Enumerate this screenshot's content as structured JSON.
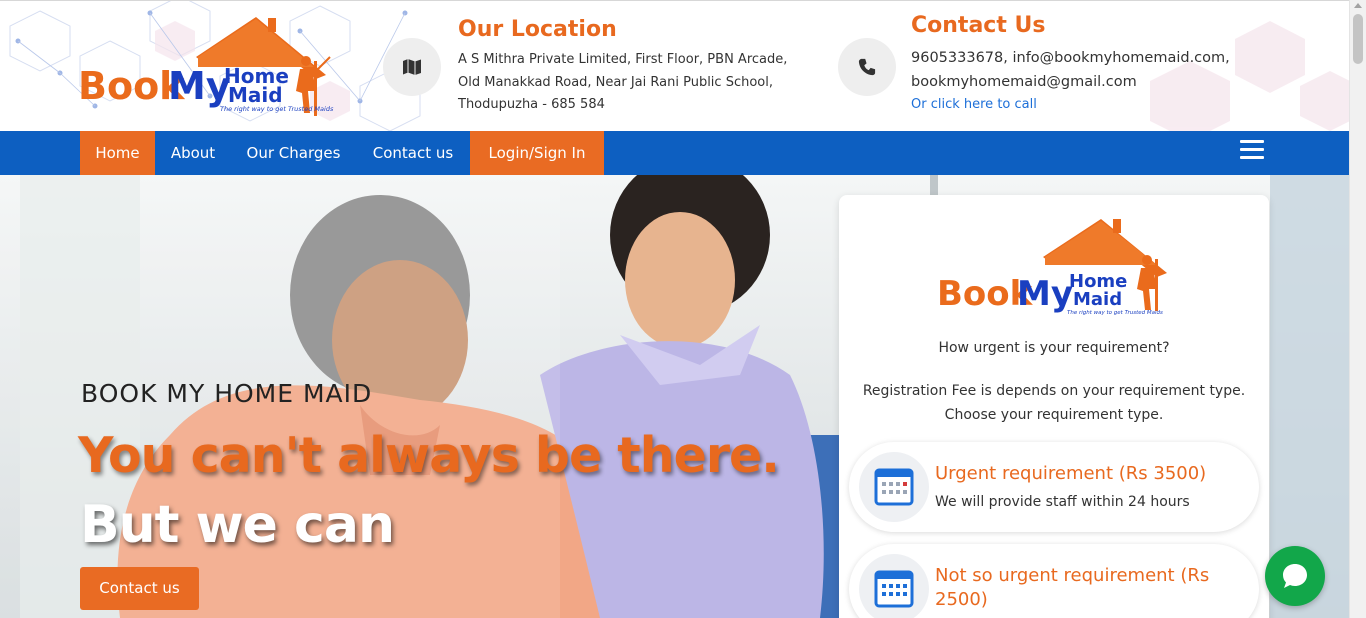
{
  "brand": {
    "word_book": "Book",
    "word_my": "My",
    "word_home": "Home",
    "word_maid": "Maid",
    "tagline": "The right way to get Trusted Maids"
  },
  "location": {
    "title": "Our Location",
    "line1": "A S Mithra Private Limited, First Floor, PBN Arcade,",
    "line2": "Old Manakkad Road, Near Jai Rani Public School,",
    "line3": "Thodupuzha - 685 584"
  },
  "contact": {
    "title": "Contact Us",
    "line1": "9605333678, info@bookmyhomemaid.com,",
    "line2": "bookmyhomemaid@gmail.com",
    "call_link": "Or click here to call"
  },
  "nav": {
    "items": [
      {
        "label": "Home"
      },
      {
        "label": "About"
      },
      {
        "label": "Our Charges"
      },
      {
        "label": "Contact us"
      },
      {
        "label": "Login/Sign In"
      }
    ]
  },
  "hero": {
    "kicker": "BOOK MY HOME MAID",
    "line1": "You can't always be there.",
    "line2": "But we can",
    "button": "Contact us"
  },
  "card": {
    "question": "How urgent is your requirement?",
    "desc1": "Registration Fee is depends on your requirement type.",
    "desc2": "Choose your requirement type.",
    "options": [
      {
        "title": "Urgent requirement (Rs 3500)",
        "subtitle": "We will provide staff within 24 hours"
      },
      {
        "title": "Not so urgent requirement (Rs 2500)",
        "subtitle": ""
      }
    ]
  },
  "colors": {
    "accent": "#e96b23",
    "nav": "#0d5fc1",
    "chat": "#12a74a"
  },
  "icons": {
    "location": "map-icon",
    "contact": "phone-icon",
    "menu": "hamburger-icon",
    "option1": "calendar-icon",
    "option2": "calendar-icon",
    "chat": "chat-bubble-icon"
  }
}
